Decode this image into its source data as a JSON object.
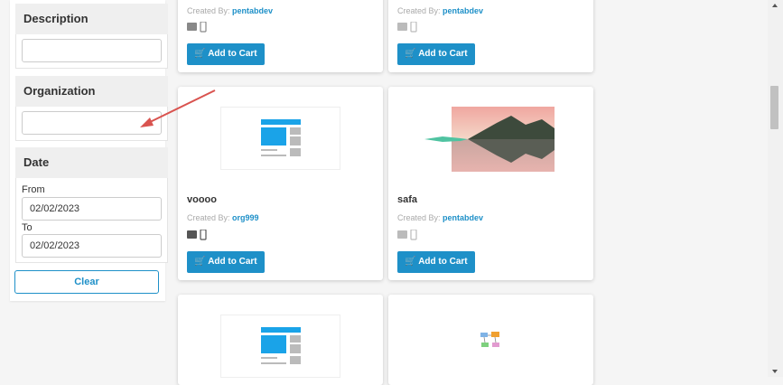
{
  "filters": {
    "description": {
      "title": "Description",
      "value": ""
    },
    "organization": {
      "title": "Organization",
      "value": ""
    },
    "date": {
      "title": "Date",
      "from_label": "From",
      "from_value": "02/02/2023",
      "to_label": "To",
      "to_value": "02/02/2023"
    },
    "clear_label": "Clear"
  },
  "cards": [
    {
      "title": "",
      "created_by_label": "Created By:",
      "author": "pentabdev",
      "button": "Add to Cart"
    },
    {
      "title": "",
      "created_by_label": "Created By:",
      "author": "pentabdev",
      "button": "Add to Cart"
    },
    {
      "title": "voooo",
      "created_by_label": "Created By:",
      "author": "org999",
      "button": "Add to Cart",
      "thumbnail": "placeholder-layout-icon"
    },
    {
      "title": "safa",
      "created_by_label": "Created By:",
      "author": "pentabdev",
      "button": "Add to Cart",
      "thumbnail": "mountain-lake-photo"
    },
    {
      "thumbnail": "placeholder-layout-icon"
    },
    {
      "thumbnail": "diagram-icon"
    }
  ],
  "colors": {
    "accent": "#1e90c8",
    "annotation_arrow": "#d9534f"
  }
}
